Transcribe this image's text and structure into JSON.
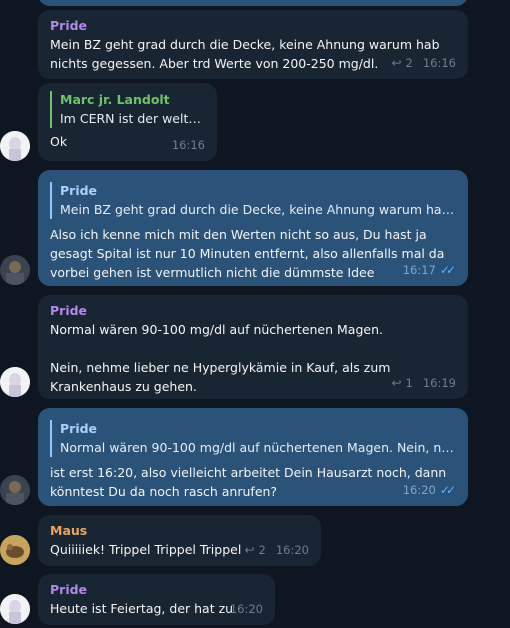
{
  "messages": [
    {
      "sender": "Pride",
      "text": "Mein BZ geht grad durch die Decke, keine Ahnung warum hab nichts gegessen. Aber trd Werte von 200-250 mg/dl.",
      "replies": "2",
      "time": "16:16"
    },
    {
      "sender": "Marc jr. Landolt",
      "quote_text": "Im CERN ist der weltw...",
      "text": "Ok",
      "time": "16:16"
    },
    {
      "quote_sender": "Pride",
      "quote_text": "Mein BZ geht grad durch die Decke, keine Ahnung warum hab nic...",
      "text": "Also ich kenne mich mit den Werten nicht so aus, Du hast ja gesagt Spital ist nur 10 Minuten entfernt, also allenfalls mal da vorbei gehen ist vermutlich nicht die dümmste Idee",
      "time": "16:17"
    },
    {
      "sender": "Pride",
      "text": "Normal wären 90-100 mg/dl auf nüchertenen Magen.\n\nNein, nehme lieber ne Hyperglykämie in Kauf, als zum Krankenhaus zu gehen.",
      "replies": "1",
      "time": "16:19"
    },
    {
      "quote_sender": "Pride",
      "quote_text": "Normal wären 90-100 mg/dl auf nüchertenen Magen.  Nein, neh...",
      "text": "ist erst 16:20, also vielleicht arbeitet Dein Hausarzt noch, dann könntest Du da noch rasch anrufen?",
      "time": "16:20"
    },
    {
      "sender": "Maus",
      "text": "Quiiiiiek! Trippel Trippel Trippel",
      "replies": "2",
      "time": "16:20"
    },
    {
      "sender": "Pride",
      "text": "Heute ist Feiertag, der hat zu",
      "time": "16:20"
    }
  ],
  "icons": {
    "reply": "reply-arrow-icon",
    "read": "double-check-icon"
  },
  "colors": {
    "background": "#0e1621",
    "incoming": "#182533",
    "outgoing": "#2b5278"
  }
}
